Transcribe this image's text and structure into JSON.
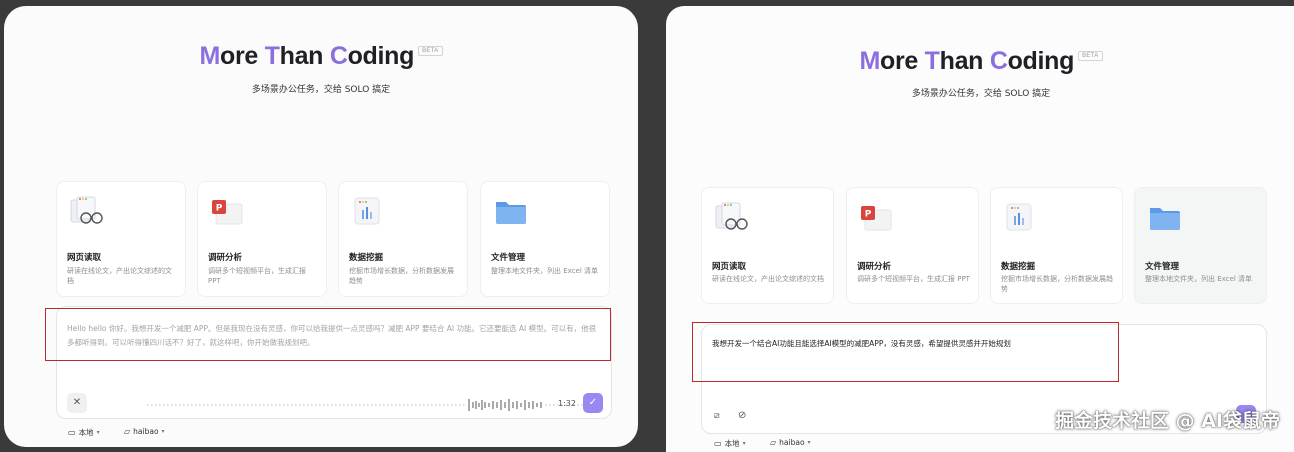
{
  "brand": {
    "parts": [
      {
        "text": "M",
        "accent": true
      },
      {
        "text": "ore ",
        "accent": false
      },
      {
        "text": "T",
        "accent": true
      },
      {
        "text": "han ",
        "accent": false
      },
      {
        "text": "C",
        "accent": true
      },
      {
        "text": "oding",
        "accent": false
      }
    ],
    "beta": "BETA",
    "subtitle": "多场景办公任务，交给 SOLO 搞定"
  },
  "cards": [
    {
      "title": "网页读取",
      "desc": "研读在线论文，产出论文综述的文档",
      "icon": "glasses-docs-icon"
    },
    {
      "title": "调研分析",
      "desc": "调研多个短视频平台，生成汇报 PPT",
      "icon": "ppt-icon"
    },
    {
      "title": "数据挖掘",
      "desc": "挖掘市场增长数据，分析数据发展趋势",
      "icon": "chart-doc-icon"
    },
    {
      "title": "文件管理",
      "desc": "整理本地文件夹，列出 Excel 清单",
      "icon": "folder-icon"
    }
  ],
  "left_input": {
    "text": "Hello hello 你好。我想开发一个减肥 APP。但是我现在没有灵感，你可以给我提供一点灵感吗？减肥 APP 要结合 AI 功能。它还要能选 AI 模型。可以有，他很多都听得到。可以听得懂四川话不？好了，就这样吧，你开始做我规划吧。",
    "timer": "1:32"
  },
  "right_input": {
    "text": "我想开发一个结合AI功能且能选择AI模型的减肥APP，没有灵感，希望提供灵感并开始规划"
  },
  "footer": {
    "local_label": "本地",
    "folder_label": "haibao"
  },
  "watermark": "掘金技术社区 @ AI袋鼠帝",
  "colors": {
    "accent": "#8b6fe0",
    "highlight": "#c0272d",
    "send": "#9b87f0"
  }
}
